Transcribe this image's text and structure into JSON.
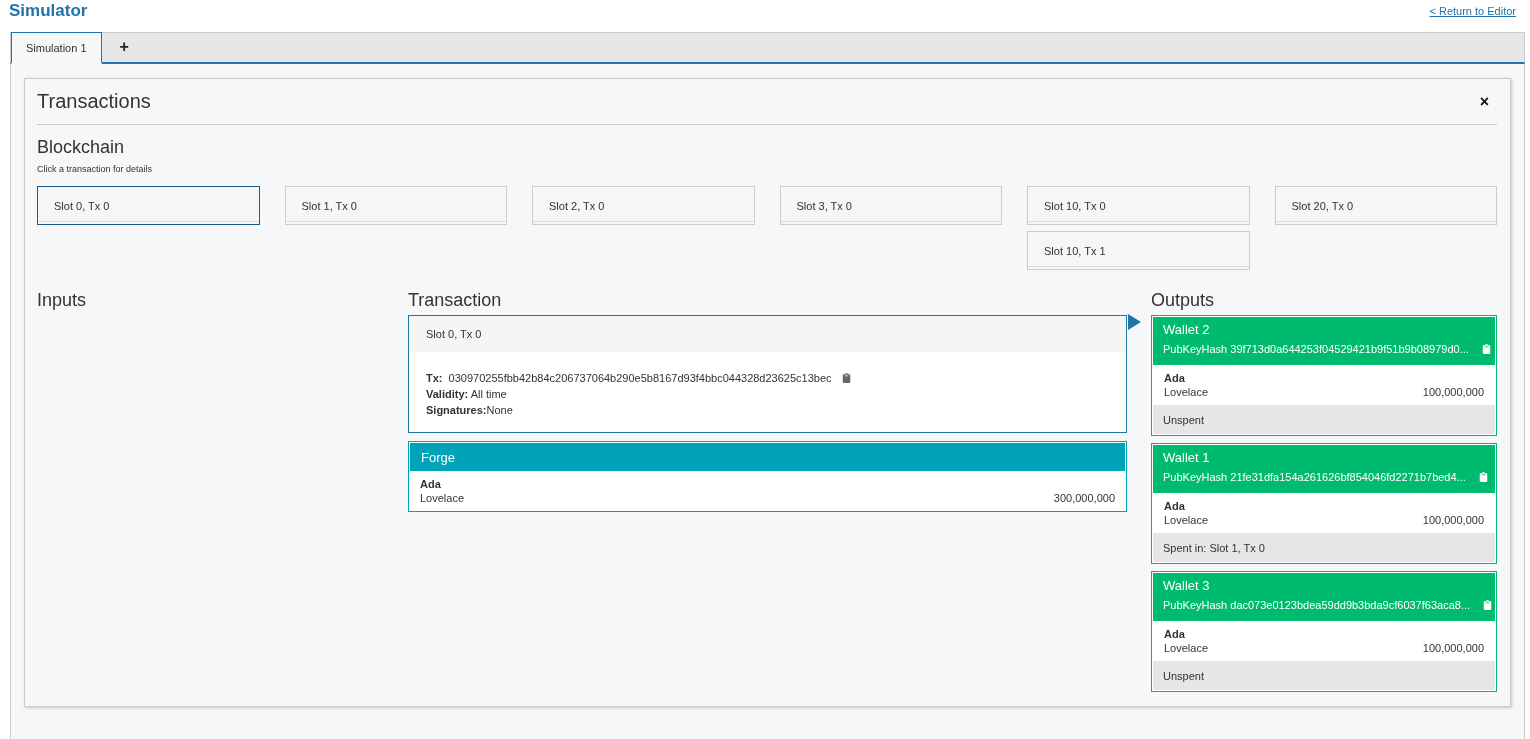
{
  "header": {
    "title": "Simulator",
    "return_link": "< Return to Editor"
  },
  "tabs": [
    {
      "label": "Simulation 1",
      "selected": true
    }
  ],
  "add_tab": "+",
  "panel": {
    "title": "Transactions",
    "close": "×"
  },
  "blockchain": {
    "title": "Blockchain",
    "hint": "Click a transaction for details",
    "columns": [
      {
        "transactions": [
          {
            "label": "Slot 0, Tx 0",
            "selected": true
          }
        ]
      },
      {
        "transactions": [
          {
            "label": "Slot 1, Tx 0",
            "selected": false
          }
        ]
      },
      {
        "transactions": [
          {
            "label": "Slot 2, Tx 0",
            "selected": false
          }
        ]
      },
      {
        "transactions": [
          {
            "label": "Slot 3, Tx 0",
            "selected": false
          }
        ]
      },
      {
        "transactions": [
          {
            "label": "Slot 10, Tx 0",
            "selected": false
          },
          {
            "label": "Slot 10, Tx 1",
            "selected": false
          }
        ]
      },
      {
        "transactions": [
          {
            "label": "Slot 20, Tx 0",
            "selected": false
          }
        ]
      }
    ]
  },
  "inputs": {
    "title": "Inputs"
  },
  "transaction": {
    "title": "Transaction",
    "slot": "Slot 0, Tx 0",
    "tx": "**Tx:**  030970255fbb42b84c206737064b290e5b8167d93f4bbc044328d23625c13bec",
    "validity": "**Validity:** All time",
    "signatures": "**Signatures:**None",
    "forge": {
      "title": "Forge",
      "currency": "Ada",
      "token": "Lovelace",
      "amount": "300,000,000"
    }
  },
  "outputs": {
    "title": "Outputs",
    "items": [
      {
        "wallet": "Wallet 2",
        "pubkey": "PubKeyHash 39f713d0a644253f04529421b9f51b9b08979d0...",
        "currency": "Ada",
        "token": "Lovelace",
        "amount": "100,000,000",
        "status": "Unspent"
      },
      {
        "wallet": "Wallet 1",
        "pubkey": "PubKeyHash 21fe31dfa154a261626bf854046fd2271b7bed4...",
        "currency": "Ada",
        "token": "Lovelace",
        "amount": "100,000,000",
        "status": "Spent in: Slot 1, Tx 0"
      },
      {
        "wallet": "Wallet 3",
        "pubkey": "PubKeyHash dac073e0123bdea59dd9b3bda9cf6037f63aca8...",
        "currency": "Ada",
        "token": "Lovelace",
        "amount": "100,000,000",
        "status": "Unspent"
      }
    ]
  }
}
